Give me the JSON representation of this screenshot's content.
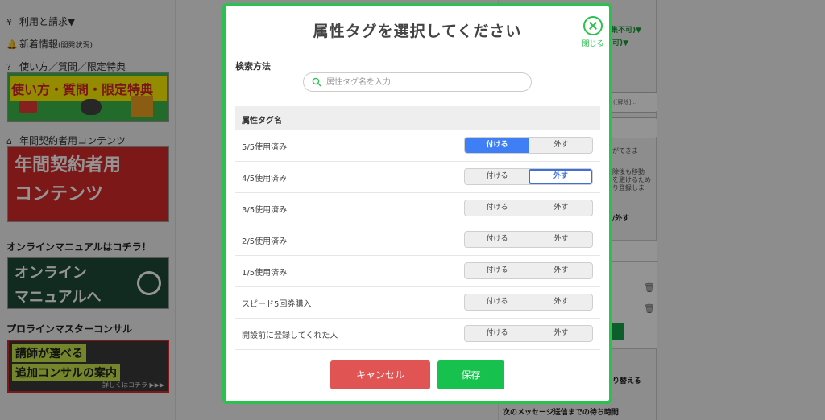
{
  "sidebar": {
    "items": [
      {
        "label": "利用と請求▼",
        "icon": "yen-icon"
      },
      {
        "label": "新着情報",
        "sub": "(開発状況)",
        "icon": "bell-icon"
      },
      {
        "label": "使い方／質問／限定特典",
        "icon": "question-icon"
      },
      {
        "label": "年間契約者用コンテンツ",
        "icon": "gift-icon"
      }
    ],
    "banners": [
      {
        "text": "使い方・質問・限定特典",
        "color": "#d4252b",
        "bg": "#3bb84a"
      },
      {
        "text_line1": "年間契約者用",
        "text_line2": "コンテンツ",
        "bg": "#d72a2a"
      },
      {
        "text_line1": "オンライン",
        "text_line2": "マニュアルへ",
        "bg": "#1f4a3a"
      },
      {
        "text_line1": "講師が選べる",
        "text_line2": "追加コンサルの案内",
        "sub": "詳しくはコチラ ▶▶▶",
        "bg": "#3a3a3a"
      }
    ],
    "headings": [
      "オンラインマニュアルはコチラ！",
      "プロラインマスターコンサル"
    ]
  },
  "background_right": {
    "green_text_1": "集不可)▼",
    "green_text_2": "可)▼",
    "select_1": "([解除]…",
    "text_1": "ができま",
    "text_2a": "除後も移動",
    "text_2b": "を避けるため",
    "text_2c": "り登録しま",
    "text_3": "/外す",
    "text_4": "り替える",
    "text_5": "次のメッセージ送信までの待ち時間"
  },
  "modal": {
    "title": "属性タグを選択してください",
    "close_label": "閉じる",
    "search_method_label": "検索方法",
    "search_placeholder": "属性タグ名を入力",
    "search_value": "",
    "table_header": "属性タグ名",
    "on_label": "付ける",
    "off_label": "外す",
    "rows": [
      {
        "name": "5/5使用済み",
        "state": "on"
      },
      {
        "name": "4/5使用済み",
        "state": "off"
      },
      {
        "name": "3/5使用済み",
        "state": "none"
      },
      {
        "name": "2/5使用済み",
        "state": "none"
      },
      {
        "name": "1/5使用済み",
        "state": "none"
      },
      {
        "name": "スピード5回券購入",
        "state": "none"
      },
      {
        "name": "開設前に登録してくれた人",
        "state": "none"
      }
    ],
    "cancel_label": "キャンセル",
    "save_label": "保存"
  },
  "colors": {
    "accent_green": "#2bc14e",
    "active_blue": "#3f7ff5",
    "cancel_red": "#e05454",
    "save_green": "#16c24d"
  }
}
